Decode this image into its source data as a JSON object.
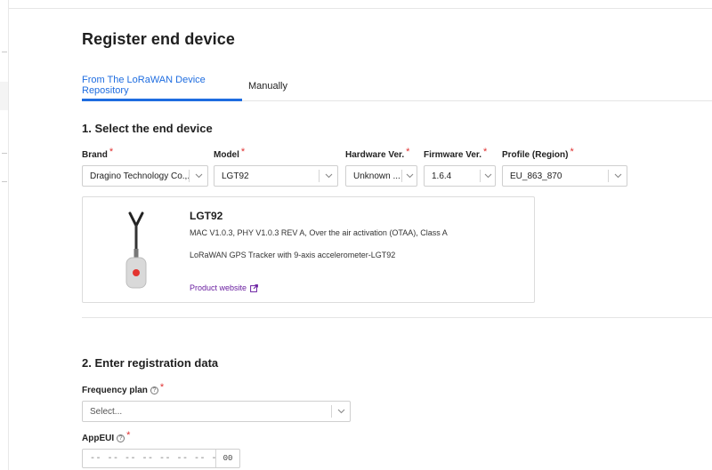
{
  "page": {
    "title": "Register end device"
  },
  "tabs": [
    {
      "label": "From The LoRaWAN Device Repository"
    },
    {
      "label": "Manually"
    }
  ],
  "section1": {
    "title": "1. Select the end device",
    "fields": {
      "brand": {
        "label": "Brand",
        "value": "Dragino Technology Co.,..."
      },
      "model": {
        "label": "Model",
        "value": "LGT92"
      },
      "hardware": {
        "label": "Hardware Ver.",
        "value": "Unknown ..."
      },
      "firmware": {
        "label": "Firmware Ver.",
        "value": "1.6.4"
      },
      "profile": {
        "label": "Profile (Region)",
        "value": "EU_863_870"
      }
    },
    "device": {
      "name": "LGT92",
      "spec": "MAC V1.0.3, PHY V1.0.3 REV A, Over the air activation (OTAA), Class A",
      "description": "LoRaWAN GPS Tracker with 9-axis accelerometer-LGT92",
      "link_label": "Product website"
    }
  },
  "section2": {
    "title": "2. Enter registration data",
    "frequency_plan": {
      "label": "Frequency plan",
      "placeholder": "Select..."
    },
    "app_eui": {
      "label": "AppEUI",
      "value": "-- -- -- -- -- -- -- --",
      "toggle_label": "00"
    }
  },
  "colors": {
    "accent": "#1f6de0",
    "required": "#e03030",
    "link": "#6a1fa0"
  },
  "icons": [
    "chevron-down-icon",
    "help-icon",
    "external-link-icon",
    "device-tracker-image"
  ]
}
